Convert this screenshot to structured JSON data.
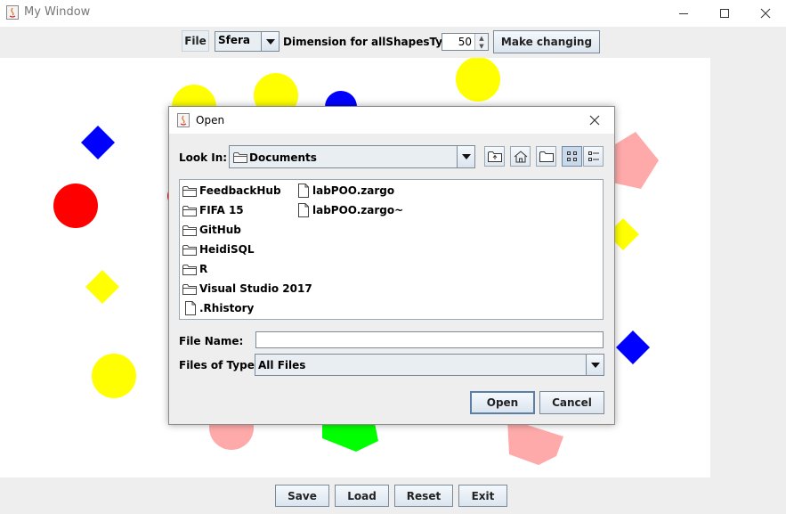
{
  "window": {
    "title": "My Window"
  },
  "toolbar": {
    "file_label": "File",
    "shape_select": "Sfera",
    "dimension_label": "Dimension for allShapesTypes",
    "dimension_value": "50",
    "make_changing_label": "Make changing"
  },
  "bottom": {
    "save": "Save",
    "load": "Load",
    "reset": "Reset",
    "exit": "Exit"
  },
  "dialog": {
    "title": "Open",
    "look_in_label": "Look In:",
    "look_in_value": "Documents",
    "files": [
      {
        "name": "FeedbackHub",
        "type": "folder"
      },
      {
        "name": "FIFA 15",
        "type": "folder"
      },
      {
        "name": "GitHub",
        "type": "folder"
      },
      {
        "name": "HeidiSQL",
        "type": "folder"
      },
      {
        "name": "R",
        "type": "folder"
      },
      {
        "name": "Visual Studio 2017",
        "type": "folder"
      },
      {
        "name": ".Rhistory",
        "type": "file"
      },
      {
        "name": "labPOO.zargo",
        "type": "file"
      },
      {
        "name": "labPOO.zargo~",
        "type": "file"
      }
    ],
    "file_name_label": "File Name:",
    "file_name_value": "",
    "files_of_type_label": "Files of Type:",
    "files_of_type_value": "All Files",
    "open_button": "Open",
    "cancel_button": "Cancel"
  },
  "colors": {
    "red": "#ff0000",
    "yellow": "#ffff00",
    "blue": "#0000ff",
    "green": "#00ff00",
    "pink": "#ffaaaa"
  },
  "icons": [
    "java-app-icon",
    "minimize-icon",
    "maximize-icon",
    "close-icon",
    "folder-icon",
    "file-icon",
    "up-folder-icon",
    "home-icon",
    "new-folder-icon",
    "list-view-icon",
    "details-view-icon",
    "chevron-down-icon"
  ]
}
